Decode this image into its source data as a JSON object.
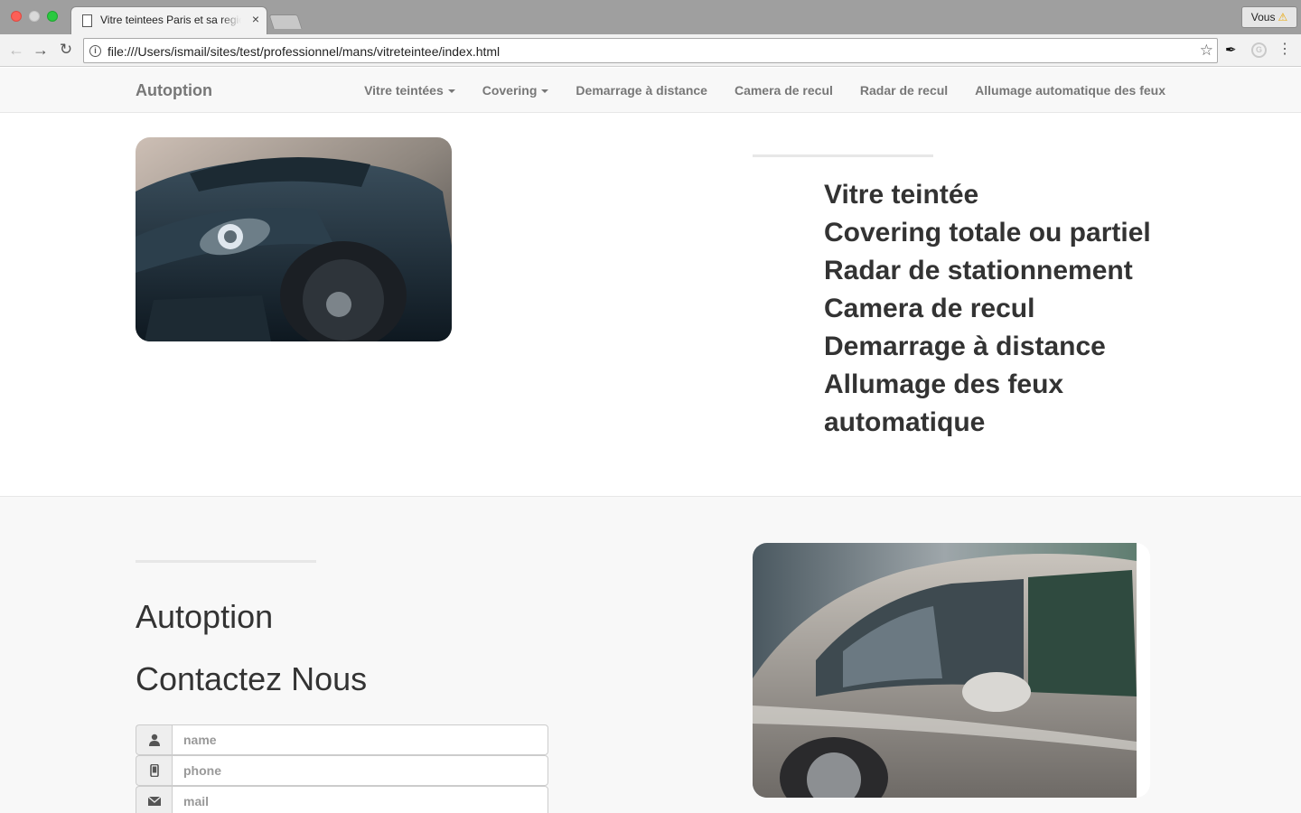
{
  "browser": {
    "tab_title": "Vitre teintees Paris et sa region",
    "tab_close": "×",
    "url": "file:///Users/ismail/sites/test/professionnel/mans/vitreteintee/index.html",
    "profile_label": "Vous",
    "icons": [
      "back-arrow-icon",
      "forward-arrow-icon",
      "reload-icon",
      "info-icon",
      "star-icon",
      "extension-icon",
      "menu-dots-icon"
    ]
  },
  "navbar": {
    "brand": "Autoption",
    "links": [
      {
        "label": "Vitre teintées",
        "dropdown": true
      },
      {
        "label": "Covering",
        "dropdown": true
      },
      {
        "label": "Demarrage à distance",
        "dropdown": false
      },
      {
        "label": "Camera de recul",
        "dropdown": false
      },
      {
        "label": "Radar de recul",
        "dropdown": false
      },
      {
        "label": "Allumage automatique des feux",
        "dropdown": false
      }
    ]
  },
  "hero": {
    "features": [
      "Vitre teintée",
      "Covering totale ou partiel",
      "Radar de stationnement",
      "Camera de recul",
      "Demarrage à distance",
      "Allumage des feux automatique"
    ]
  },
  "contact": {
    "brand_heading": "Autoption",
    "heading": "Contactez Nous",
    "fields": [
      {
        "icon": "user-icon",
        "placeholder": "name"
      },
      {
        "icon": "mobile-phone-icon",
        "placeholder": "phone"
      },
      {
        "icon": "envelope-icon",
        "placeholder": "mail"
      }
    ]
  },
  "colors": {
    "navbar_bg": "#f8f8f8",
    "nav_text": "#777777",
    "heading_text": "#333333",
    "section_alt_bg": "#f8f8f8"
  }
}
